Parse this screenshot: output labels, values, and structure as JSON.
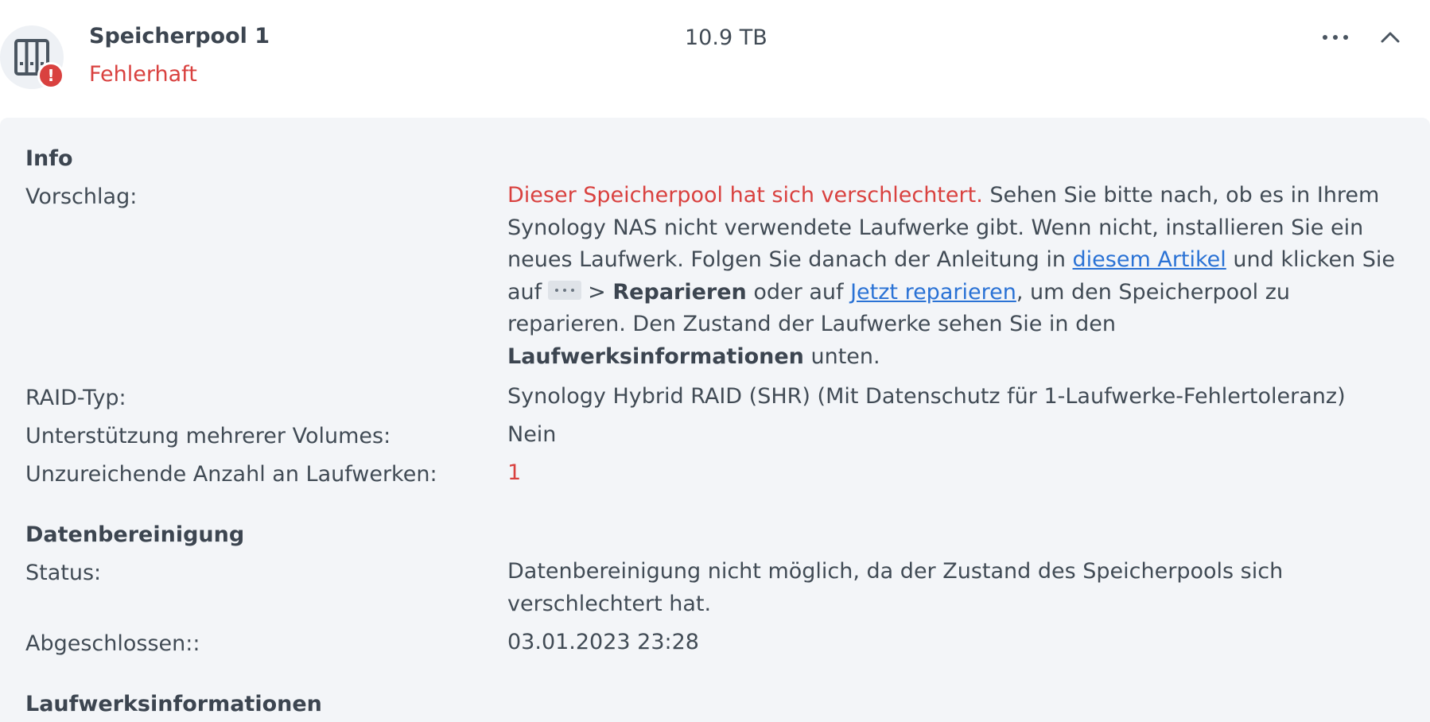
{
  "pool": {
    "name": "Speicherpool 1",
    "status": "Fehlerhaft",
    "size": "10.9 TB",
    "icon": "storage-pool-icon",
    "status_icon": "error-badge-icon"
  },
  "colors": {
    "error": "#d9413f",
    "link": "#2a72d5",
    "panel_bg": "#f3f5f8"
  },
  "info": {
    "section_title": "Info",
    "suggestion_label": "Vorschlag:",
    "suggestion": {
      "warning": "Dieser Speicherpool hat sich verschlechtert.",
      "text1": " Sehen Sie bitte nach, ob es in Ihrem Synology NAS nicht verwendete Laufwerke gibt. Wenn nicht, installieren Sie ein neues Laufwerk. Folgen Sie danach der Anleitung in ",
      "article_link": "diesem Artikel",
      "text2": " und klicken Sie auf",
      "arrow": "> ",
      "repair_bold": "Reparieren",
      "text3": " oder auf ",
      "repair_link": "Jetzt reparieren",
      "text4": ", um den Speicherpool zu reparieren. Den Zustand der Laufwerke sehen Sie in den ",
      "drive_info_bold": "Laufwerksinformationen",
      "text5": " unten."
    },
    "raid_label": "RAID-Typ:",
    "raid_value": "Synology Hybrid RAID (SHR) (Mit Datenschutz für 1-Laufwerke-Fehlertoleranz)",
    "multi_volume_label": "Unterstützung mehrerer Volumes:",
    "multi_volume_value": "Nein",
    "insufficient_label": "Unzureichende Anzahl an Laufwerken:",
    "insufficient_value": "1"
  },
  "scrub": {
    "section_title": "Datenbereinigung",
    "status_label": "Status:",
    "status_value": "Datenbereinigung nicht möglich, da der Zustand des Speicherpools sich verschlechtert hat.",
    "completed_label": "Abgeschlossen::",
    "completed_value": "03.01.2023 23:28"
  },
  "drives": {
    "section_title": "Laufwerksinformationen"
  }
}
